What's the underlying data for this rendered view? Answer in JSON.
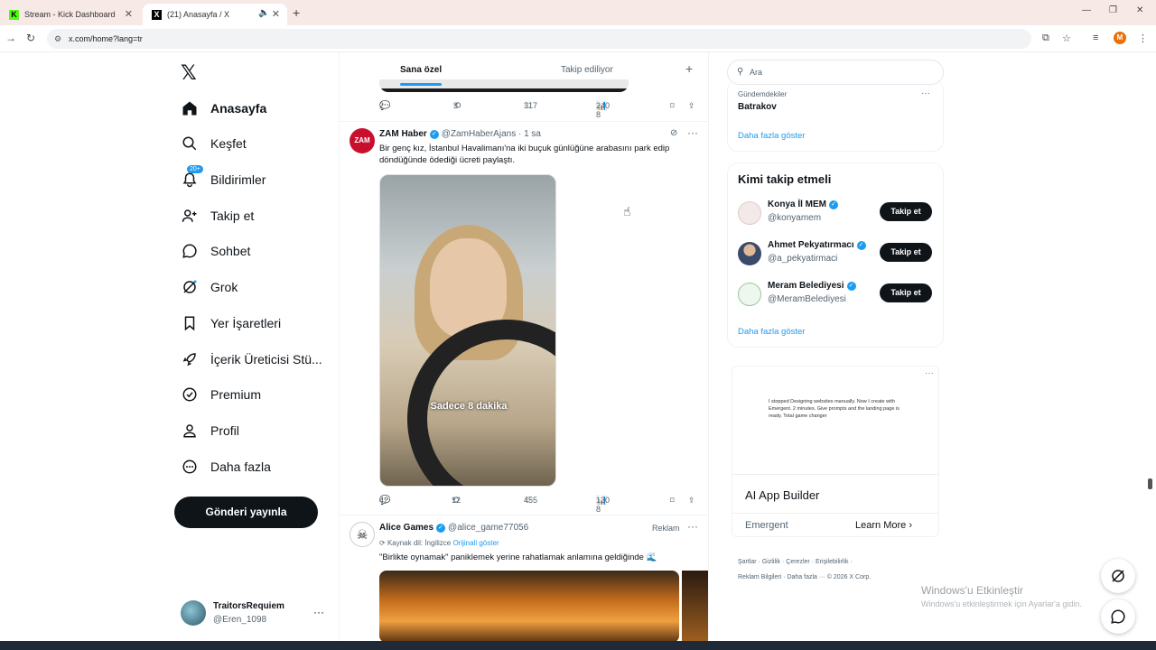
{
  "browser": {
    "tabs": [
      {
        "label": "Stream - Kick Dashboard"
      },
      {
        "label": "(21) Anasayfa / X"
      }
    ],
    "url": "x.com/home?lang=tr"
  },
  "nav": {
    "items": [
      {
        "label": "Anasayfa",
        "icon": "home-icon"
      },
      {
        "label": "Keşfet",
        "icon": "search-icon"
      },
      {
        "label": "Bildirimler",
        "icon": "bell-icon",
        "badge": "20+"
      },
      {
        "label": "Takip et",
        "icon": "follow-icon"
      },
      {
        "label": "Sohbet",
        "icon": "chat-icon"
      },
      {
        "label": "Grok",
        "icon": "grok-icon"
      },
      {
        "label": "Yer İşaretleri",
        "icon": "bookmark-icon"
      },
      {
        "label": "İçerik Üreticisi Stü...",
        "icon": "rocket-icon"
      },
      {
        "label": "Premium",
        "icon": "premium-icon"
      },
      {
        "label": "Profil",
        "icon": "profile-icon"
      },
      {
        "label": "Daha fazla",
        "icon": "more-icon"
      }
    ],
    "post_button": "Gönderi yayınla",
    "user": {
      "name": "TraitorsRequiem",
      "handle": "@Eren_1098"
    }
  },
  "feed": {
    "tabs": [
      "Sana özel",
      "Takip ediliyor"
    ],
    "prev_actions": {
      "replies": "2",
      "reposts": "3",
      "likes": "317",
      "views": "240 8"
    },
    "tweet1": {
      "name": "ZAM Haber",
      "handle": "@ZamHaberAjans · 1 sa",
      "text": "Bir genç kız, İstanbul Havalimanı'na iki buçuk günlüğüne arabasını park edip döndüğünde ödediği ücreti paylaştı.",
      "avatar_text": "ZAM",
      "caption": "Sadece 8 dakika",
      "replies": "42",
      "reposts": "12",
      "likes": "455",
      "views": "130 8"
    },
    "tweet2": {
      "name": "Alice Games",
      "handle": "@alice_game77056",
      "ad_label": "Reklam",
      "source": "Kaynak dil: İngilizce",
      "source_link": "Orijinali göster",
      "text": "\"Birlikte oynamak\" paniklemek yerine rahatlamak anlamına geldiğinde 🌊"
    }
  },
  "right": {
    "search_placeholder": "Ara",
    "trend": {
      "category": "Gündemdekiler",
      "name": "Batrakov"
    },
    "more_link": "Daha fazla göster",
    "who_to_follow": "Kimi takip etmeli",
    "follow_label": "Takip et",
    "suggestions": [
      {
        "name": "Konya İl MEM",
        "handle": "@konyamem"
      },
      {
        "name": "Ahmet Pekyatırmacı",
        "handle": "@a_pekyatirmaci"
      },
      {
        "name": "Meram Belediyesi",
        "handle": "@MeramBelediyesi"
      }
    ],
    "ad": {
      "mini_text": "I stopped Designing websites manually. Now I create with Emergent. 2 minutes. Give prompts and the landing page is ready. Total game changer",
      "title": "AI App Builder",
      "brand": "Emergent",
      "cta": "Learn More"
    },
    "footer1": "Şartlar · Gizlilik · Çerezler · Erişilebilirlik ·",
    "footer2": "Reklam Bilgileri · Daha fazla ··· © 2026 X Corp."
  },
  "windows": {
    "wm_title": "Windows'u Etkinleştir",
    "wm_sub": "Windows'u etkinleştirmek için Ayarlar'a gidin."
  },
  "colors": {
    "accent": "#1d9bf0",
    "text": "#0f1419",
    "muted": "#536471"
  }
}
